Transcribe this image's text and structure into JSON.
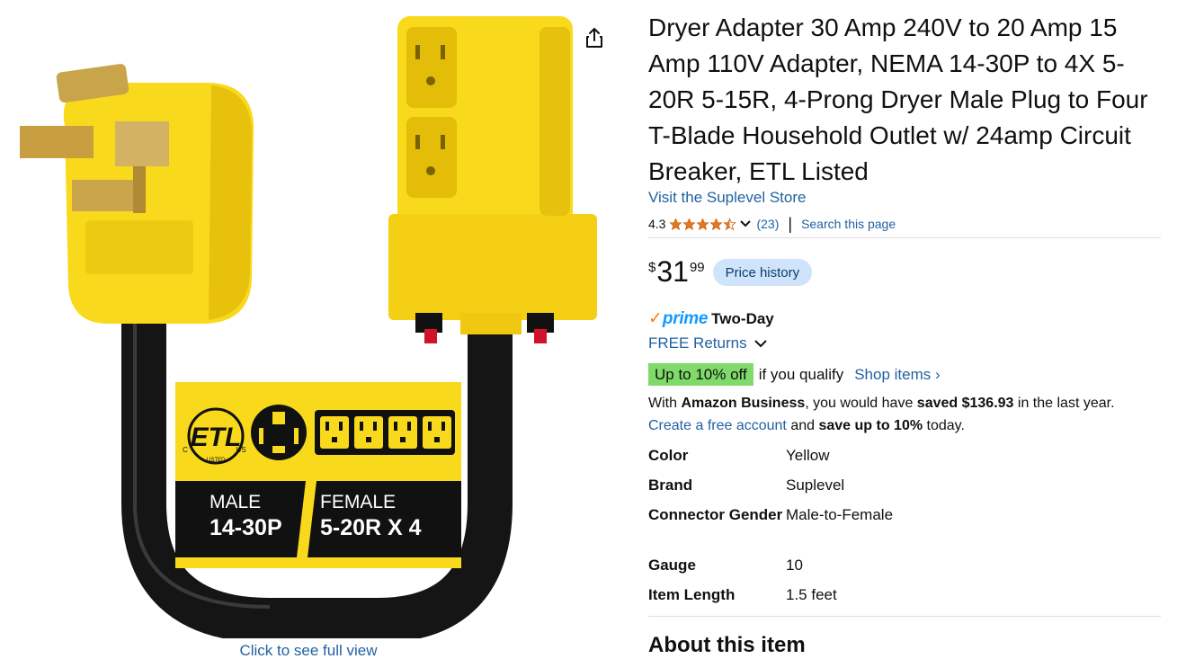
{
  "product": {
    "title": "Dryer Adapter 30 Amp 240V to 20 Amp 15 Amp 110V Adapter, NEMA 14-30P to 4X 5-20R 5-15R, 4-Prong Dryer Male Plug to Four T-Blade Household Outlet w/ 24amp Circuit Breaker, ETL Listed",
    "store_link": "Visit the Suplevel Store",
    "rating": "4.3",
    "rating_value": 4.3,
    "rating_count": "(23)",
    "search_page": "Search this page"
  },
  "image": {
    "full_view_label": "Click to see full view",
    "label_male_title": "MALE",
    "label_male_code": "14-30P",
    "label_female_title": "FEMALE",
    "label_female_code": "5-20R X 4",
    "etl_text": "ETL",
    "etl_c": "C",
    "etl_us": "US",
    "etl_listed": "LISTED",
    "colors": {
      "yellow": "#f9d91b",
      "yellow_dark": "#e0b800",
      "cable": "#1a1a1a",
      "label_black": "#111111"
    }
  },
  "price": {
    "symbol": "$",
    "whole": "31",
    "fraction": "99",
    "history_label": "Price history"
  },
  "delivery": {
    "prime_check": "✓",
    "prime_word": "prime",
    "prime_speed": "Two-Day",
    "returns_label": "FREE Returns"
  },
  "discount": {
    "badge": "Up to 10% off",
    "qualify": "if you qualify",
    "shop_items": "Shop items ›"
  },
  "business": {
    "with": "With ",
    "amazon_business": "Amazon Business",
    "would_have": ", you would have ",
    "saved": "saved $136.93",
    "last_year": " in the last year.",
    "create_account": "Create a free account",
    "and": " and ",
    "save_up": "save up to 10%",
    "today": " today."
  },
  "specs": [
    {
      "key": "Color",
      "value": "Yellow"
    },
    {
      "key": "Brand",
      "value": "Suplevel"
    },
    {
      "key": "Connector Gender",
      "value": "Male-to-Female"
    },
    {
      "key": "Gauge",
      "value": "10"
    },
    {
      "key": "Item Length",
      "value": "1.5 feet"
    }
  ],
  "about_heading": "About this item",
  "colors": {
    "link": "#2162a1",
    "price_history_bg": "#cfe4fa",
    "discount_green": "#7fda69",
    "star": "#de7921",
    "prime_blue": "#1399ff",
    "prime_orange": "#f08804"
  },
  "icons": {
    "share": "share-icon",
    "star": "star-icon",
    "chevron": "chevron-down-icon"
  }
}
